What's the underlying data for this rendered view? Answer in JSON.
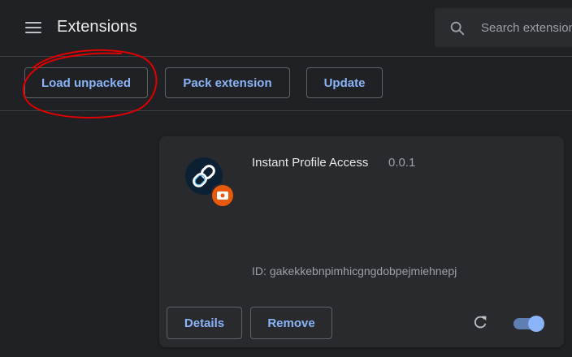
{
  "header": {
    "title": "Extensions",
    "menu_icon": "menu-icon",
    "search": {
      "placeholder": "Search extensions",
      "icon": "search-icon"
    }
  },
  "toolbar": {
    "load_unpacked": "Load unpacked",
    "pack_extension": "Pack extension",
    "update": "Update"
  },
  "extension": {
    "name": "Instant Profile Access",
    "version": "0.0.1",
    "id_label": "ID:",
    "id": "gakekkebnpimhicgngdobpejmiehnepj",
    "icon": "link-icon",
    "badge_icon": "unpacked-badge-icon",
    "details_label": "Details",
    "remove_label": "Remove",
    "reload_icon": "reload-icon",
    "enabled": true
  },
  "colors": {
    "background": "#202124",
    "card": "#292a2d",
    "accent": "#8ab4f8",
    "annotation": "#e00000"
  }
}
